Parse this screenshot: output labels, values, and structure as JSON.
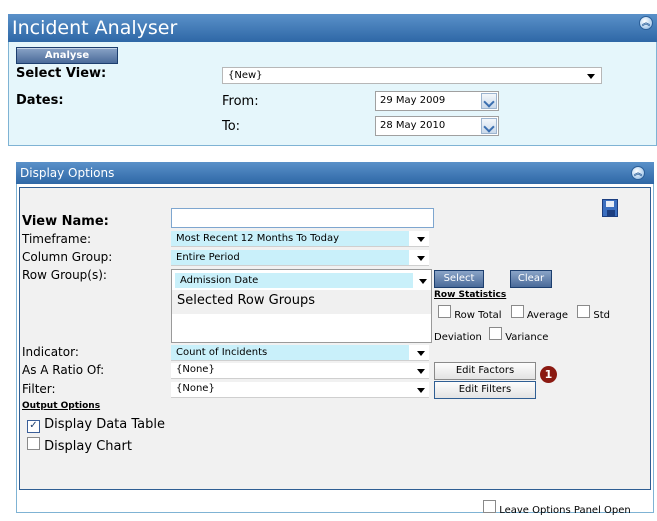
{
  "header": {
    "title": "Incident Analyser"
  },
  "top": {
    "analyse_label": "Analyse",
    "select_view_label": "Select View:",
    "select_view_value": "{New}",
    "dates_label": "Dates:",
    "from_label": "From:",
    "from_value": "29 May 2009",
    "to_label": "To:",
    "to_value": "28 May 2010"
  },
  "display": {
    "title": "Display Options",
    "view_name_label": "View Name:",
    "view_name_value": "",
    "timeframe_label": "Timeframe:",
    "timeframe_value": "Most Recent 12 Months To Today",
    "column_group_label": "Column Group:",
    "column_group_value": "Entire Period",
    "row_groups_label": "Row Group(s):",
    "row_group_value": "Admission Date",
    "selected_row_groups": "Selected Row Groups",
    "select_label": "Select",
    "clear_label": "Clear",
    "row_statistics_label": "Row Statistics",
    "row_total_label": "Row Total",
    "average_label": "Average",
    "std_label": "Std",
    "deviation_label": "Deviation",
    "variance_label": "Variance",
    "indicator_label": "Indicator:",
    "indicator_value": "Count of Incidents",
    "ratio_label": "As A Ratio Of:",
    "ratio_value": "{None}",
    "edit_factors_label": "Edit Factors",
    "callout_number": "1",
    "filter_label": "Filter:",
    "filter_value": "{None}",
    "edit_filters_label": "Edit Filters",
    "output_options_label": "Output Options",
    "display_data_table_label": "Display Data Table",
    "display_data_table_checked": true,
    "display_chart_label": "Display Chart",
    "display_chart_checked": false,
    "leave_open_label": "Leave Options Panel Open",
    "leave_open_checked": false
  },
  "colors": {
    "header_blue": "#3a75b4",
    "panel_cyan": "#e5f6fb",
    "field_cyan": "#c9f0fa",
    "callout_red": "#8b1a12"
  },
  "icons": [
    "collapse-icon",
    "save-disk-icon",
    "chevron-down-icon",
    "dropdown-arrow-icon"
  ]
}
